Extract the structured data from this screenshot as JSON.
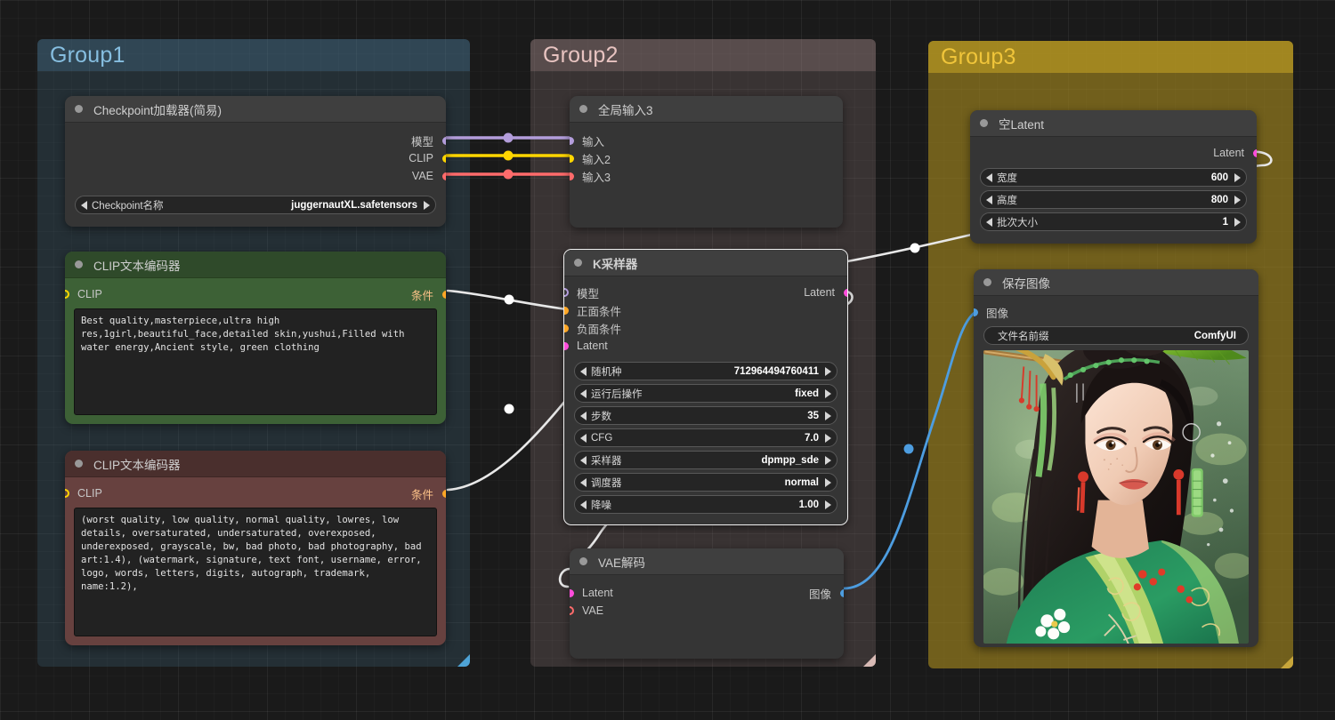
{
  "groups": [
    {
      "id": "group1",
      "title": "Group1",
      "color": "#86bee0"
    },
    {
      "id": "group2",
      "title": "Group2",
      "color": "#e7c3c0"
    },
    {
      "id": "group3",
      "title": "Group3",
      "color": "#f0c53a"
    }
  ],
  "nodes": {
    "checkpoint_loader": {
      "title": "Checkpoint加载器(简易)",
      "outputs": [
        {
          "label": "模型",
          "color": "#b39ddb"
        },
        {
          "label": "CLIP",
          "color": "#ffd600"
        },
        {
          "label": "VAE",
          "color": "#ff6b6b"
        }
      ],
      "widgets": [
        {
          "name": "Checkpoint名称",
          "value": "juggernautXL.safetensors"
        }
      ]
    },
    "clip_positive": {
      "title": "CLIP文本编码器",
      "input": {
        "label": "CLIP",
        "color": "#ffd600"
      },
      "output": {
        "label": "条件",
        "color": "#ffa726"
      },
      "text": "Best quality,masterpiece,ultra high res,1girl,beautiful_face,detailed skin,yushui,Filled with water energy,Ancient style, green clothing"
    },
    "clip_negative": {
      "title": "CLIP文本编码器",
      "input": {
        "label": "CLIP",
        "color": "#ffd600"
      },
      "output": {
        "label": "条件",
        "color": "#ffa726"
      },
      "text": "(worst quality, low quality, normal quality, lowres, low details, oversaturated, undersaturated, overexposed, underexposed, grayscale, bw, bad photo, bad photography, bad art:1.4), (watermark, signature, text font, username, error, logo, words, letters, digits, autograph, trademark, name:1.2),"
    },
    "global_input": {
      "title": "全局输入3",
      "inputs": [
        {
          "label": "输入",
          "color": "#b39ddb"
        },
        {
          "label": "输入2",
          "color": "#ffd600"
        },
        {
          "label": "输入3",
          "color": "#ff6b6b"
        }
      ]
    },
    "ksampler": {
      "title": "K采样器",
      "inputs": [
        {
          "label": "模型",
          "color": "#b39ddb",
          "ring": true
        },
        {
          "label": "正面条件",
          "color": "#ffa726",
          "ring": false
        },
        {
          "label": "负面条件",
          "color": "#ffa726",
          "ring": false
        },
        {
          "label": "Latent",
          "color": "#ff4ddb",
          "ring": false
        }
      ],
      "outputs": [
        {
          "label": "Latent",
          "color": "#ff4ddb"
        }
      ],
      "widgets": [
        {
          "name": "随机种",
          "value": "712964494760411"
        },
        {
          "name": "运行后操作",
          "value": "fixed"
        },
        {
          "name": "步数",
          "value": "35"
        },
        {
          "name": "CFG",
          "value": "7.0"
        },
        {
          "name": "采样器",
          "value": "dpmpp_sde"
        },
        {
          "name": "调度器",
          "value": "normal"
        },
        {
          "name": "降噪",
          "value": "1.00"
        }
      ]
    },
    "vae_decode": {
      "title": "VAE解码",
      "inputs": [
        {
          "label": "Latent",
          "color": "#ff4ddb",
          "ring": false
        },
        {
          "label": "VAE",
          "color": "#ff6b6b",
          "ring": true
        }
      ],
      "outputs": [
        {
          "label": "图像",
          "color": "#4d9de0"
        }
      ]
    },
    "empty_latent": {
      "title": "空Latent",
      "outputs": [
        {
          "label": "Latent",
          "color": "#ff4ddb"
        }
      ],
      "widgets": [
        {
          "name": "宽度",
          "value": "600"
        },
        {
          "name": "高度",
          "value": "800"
        },
        {
          "name": "批次大小",
          "value": "1"
        }
      ]
    },
    "save_image": {
      "title": "保存图像",
      "inputs": [
        {
          "label": "图像",
          "color": "#4d9de0"
        }
      ],
      "widgets": [
        {
          "name": "文件名前缀",
          "value": "ComfyUI"
        }
      ],
      "preview_alt": "generated portrait of a woman in green hanfu with leaf parasol"
    }
  },
  "colors": {
    "model": "#b39ddb",
    "clip": "#ffd600",
    "vae": "#ff6b6b",
    "conditioning": "#ffa726",
    "latent": "#ff4ddb",
    "image": "#4d9de0",
    "wire": "#e8e8e8",
    "wire_image": "#4d9de0",
    "node_bg": "#353535",
    "canvas_bg": "#1a1a1a"
  }
}
